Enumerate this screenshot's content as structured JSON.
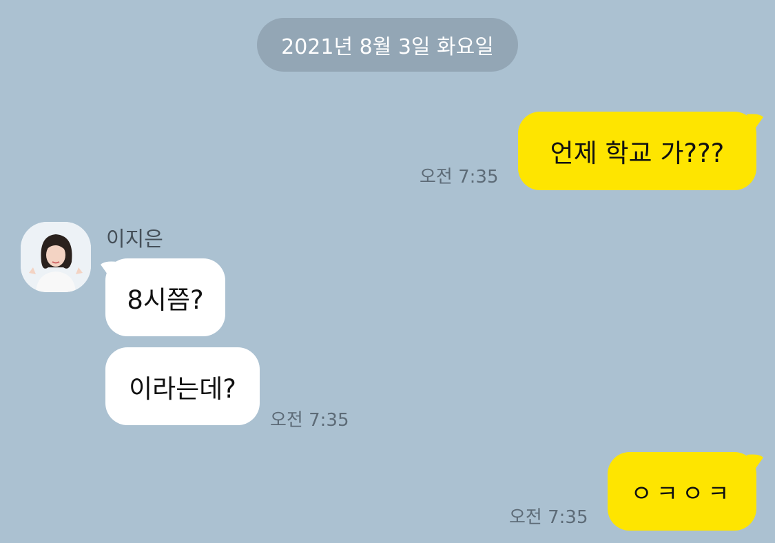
{
  "date_divider": "2021년 8월 3일 화요일",
  "contact": {
    "name": "이지은"
  },
  "messages": [
    {
      "sender": "me",
      "text": "언제 학교 가???",
      "time": "오전 7:35"
    },
    {
      "sender": "them",
      "text": "8시쯤?",
      "time": ""
    },
    {
      "sender": "them",
      "text": "이라는데?",
      "time": "오전 7:35"
    },
    {
      "sender": "me",
      "text": "ㅇㅋㅇㅋ",
      "time": "오전 7:35"
    }
  ],
  "colors": {
    "background": "#abc1d1",
    "my_bubble": "#fee500",
    "their_bubble": "#ffffff",
    "date_pill": "#93a6b5",
    "timestamp": "#5d6b77"
  }
}
